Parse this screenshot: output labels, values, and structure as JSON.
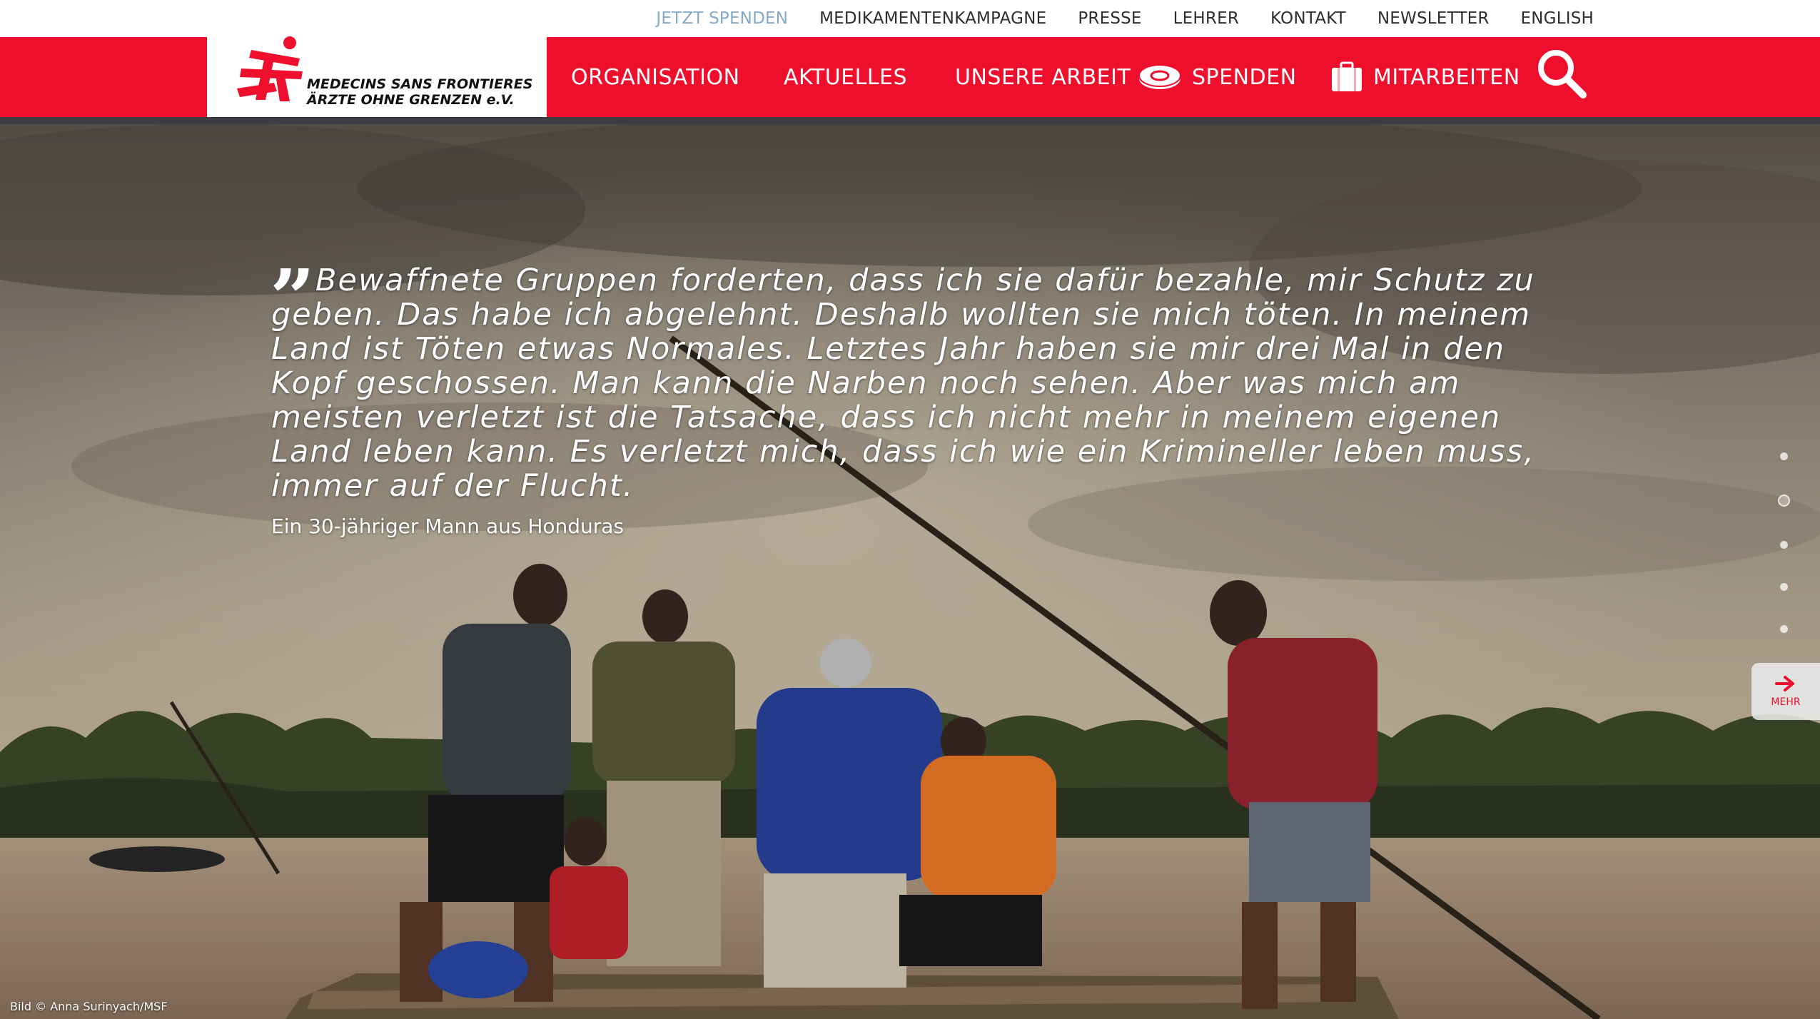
{
  "utility_nav": {
    "items": [
      {
        "label": "JETZT SPENDEN",
        "accent": true
      },
      {
        "label": "MEDIKAMENTENKAMPAGNE"
      },
      {
        "label": "PRESSE"
      },
      {
        "label": "LEHRER"
      },
      {
        "label": "KONTAKT"
      },
      {
        "label": "NEWSLETTER"
      },
      {
        "label": "ENGLISH"
      }
    ]
  },
  "logo": {
    "line1": "MEDECINS SANS FRONTIERES",
    "line2": "ÄRZTE OHNE GRENZEN e.V."
  },
  "main_nav": {
    "items": [
      {
        "label": "ORGANISATION"
      },
      {
        "label": "AKTUELLES"
      },
      {
        "label": "UNSERE ARBEIT"
      },
      {
        "label": "SPENDEN",
        "icon": "coin-icon"
      },
      {
        "label": "MITARBEITEN",
        "icon": "briefcase-icon"
      }
    ],
    "search_icon": "search-icon"
  },
  "hero": {
    "quote_mark": "”",
    "quote": "Bewaffnete Gruppen forderten, dass ich sie dafür bezahle, mir Schutz zu geben. Das habe ich abgelehnt. Deshalb wollten sie mich töten. In meinem Land ist Töten etwas Normales. Letztes Jahr haben sie mir drei Mal in den Kopf geschossen. Man kann die Narben noch sehen. Aber was mich am meisten verletzt ist die Tatsache, dass ich nicht mehr in meinem eigenen Land leben kann. Es verletzt mich, dass ich wie ein Krimineller leben muss, immer auf der Flucht.",
    "author": "Ein 30-jähriger Mann aus Honduras",
    "credit": "Bild © Anna Surinyach/MSF",
    "slides": 5,
    "active_slide": 2,
    "more_label": "MEHR",
    "more_icon": "arrow-right-icon"
  },
  "colors": {
    "brand_red": "#ee0f2c",
    "accent_blue": "#86a9c4",
    "nav_shadow": "#3c3c44"
  }
}
